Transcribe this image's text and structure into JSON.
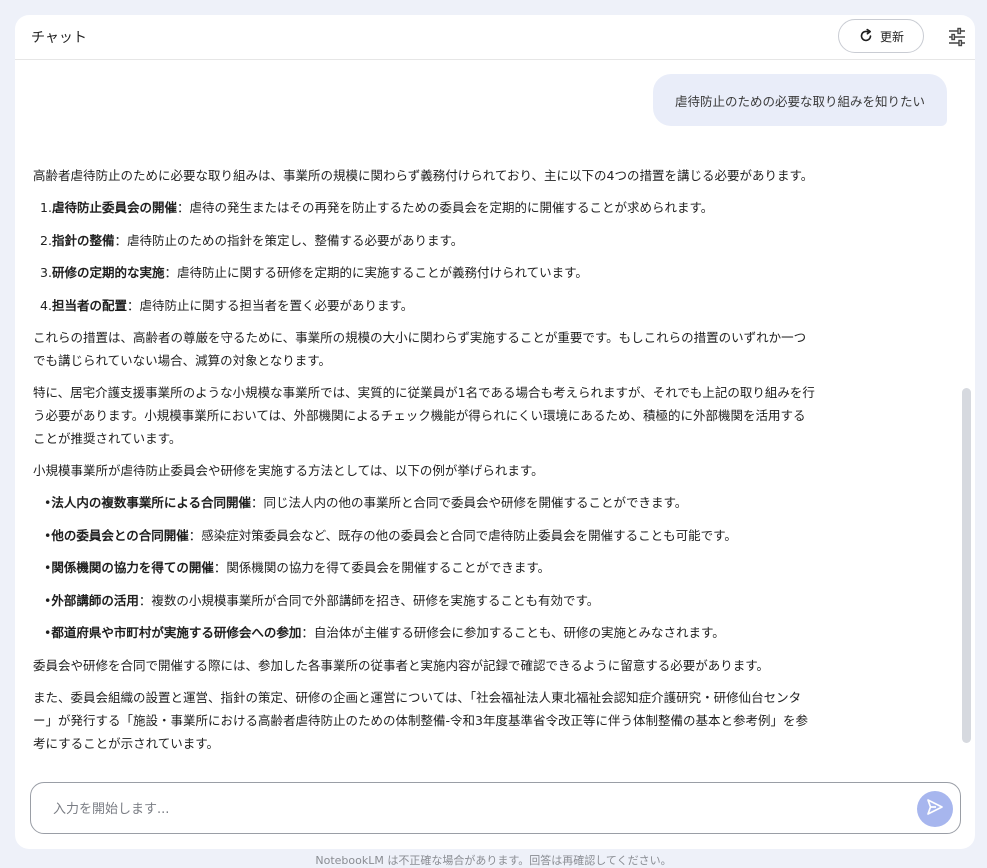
{
  "header": {
    "title": "チャット",
    "refresh_label": "更新",
    "refresh_icon": "refresh-icon",
    "settings_icon": "tune-icon"
  },
  "user_message": "虐待防止のための必要な取り組みを知りたい",
  "answer": {
    "intro": "高齢者虐待防止のために必要な取り組みは、事業所の規模に関わらず義務付けられており、主に以下の4つの措置を講じる必要があります。",
    "measures": [
      {
        "num": "1.",
        "title": "虐待防止委員会の開催",
        "text": "：虐待の発生またはその再発を防止するための委員会を定期的に開催することが求められます。"
      },
      {
        "num": "2.",
        "title": "指針の整備",
        "text": "：虐待防止のための指針を策定し、整備する必要があります。"
      },
      {
        "num": "3.",
        "title": "研修の定期的な実施",
        "text": "：虐待防止に関する研修を定期的に実施することが義務付けられています。"
      },
      {
        "num": "4.",
        "title": "担当者の配置",
        "text": "：虐待防止に関する担当者を置く必要があります。"
      }
    ],
    "para1": "これらの措置は、高齢者の尊厳を守るために、事業所の規模の大小に関わらず実施することが重要です。もしこれらの措置のいずれか一つでも講じられていない場合、減算の対象となります。",
    "para2": "特に、居宅介護支援事業所のような小規模な事業所では、実質的に従業員が1名である場合も考えられますが、それでも上記の取り組みを行う必要があります。小規模事業所においては、外部機関によるチェック機能が得られにくい環境にあるため、積極的に外部機関を活用することが推奨されています。",
    "para3": "小規模事業所が虐待防止委員会や研修を実施する方法としては、以下の例が挙げられます。",
    "methods": [
      {
        "bullet": "•",
        "title": "法人内の複数事業所による合同開催",
        "text": "：同じ法人内の他の事業所と合同で委員会や研修を開催することができます。"
      },
      {
        "bullet": "•",
        "title": "他の委員会との合同開催",
        "text": "：感染症対策委員会など、既存の他の委員会と合同で虐待防止委員会を開催することも可能です。"
      },
      {
        "bullet": "•",
        "title": "関係機関の協力を得ての開催",
        "text": "：関係機関の協力を得て委員会を開催することができます。"
      },
      {
        "bullet": "•",
        "title": "外部講師の活用",
        "text": "：複数の小規模事業所が合同で外部講師を招き、研修を実施することも有効です。"
      },
      {
        "bullet": "•",
        "title": "都道府県や市町村が実施する研修会への参加",
        "text": "：自治体が主催する研修会に参加することも、研修の実施とみなされます。"
      }
    ],
    "para4": "委員会や研修を合同で開催する際には、参加した各事業所の従事者と実施内容が記録で確認できるように留意する必要があります。",
    "para5": "また、委員会組織の設置と運営、指針の策定、研修の企画と運営については、「社会福祉法人東北福祉会認知症介護研究・研修仙台センター」が発行する「施設・事業所における高齢者虐待防止のための体制整備-令和3年度基準省令改正等に伴う体制整備の基本と参考例」を参考にすることが示されています。"
  },
  "input": {
    "placeholder": "入力を開始します...",
    "value": "",
    "send_icon": "send-icon"
  },
  "footer_note": "NotebookLM は不正確な場合があります。回答は再確認してください。",
  "colors": {
    "background": "#eef1f9",
    "user_bubble": "#e9edf9",
    "send_button": "#a7b6ee"
  }
}
